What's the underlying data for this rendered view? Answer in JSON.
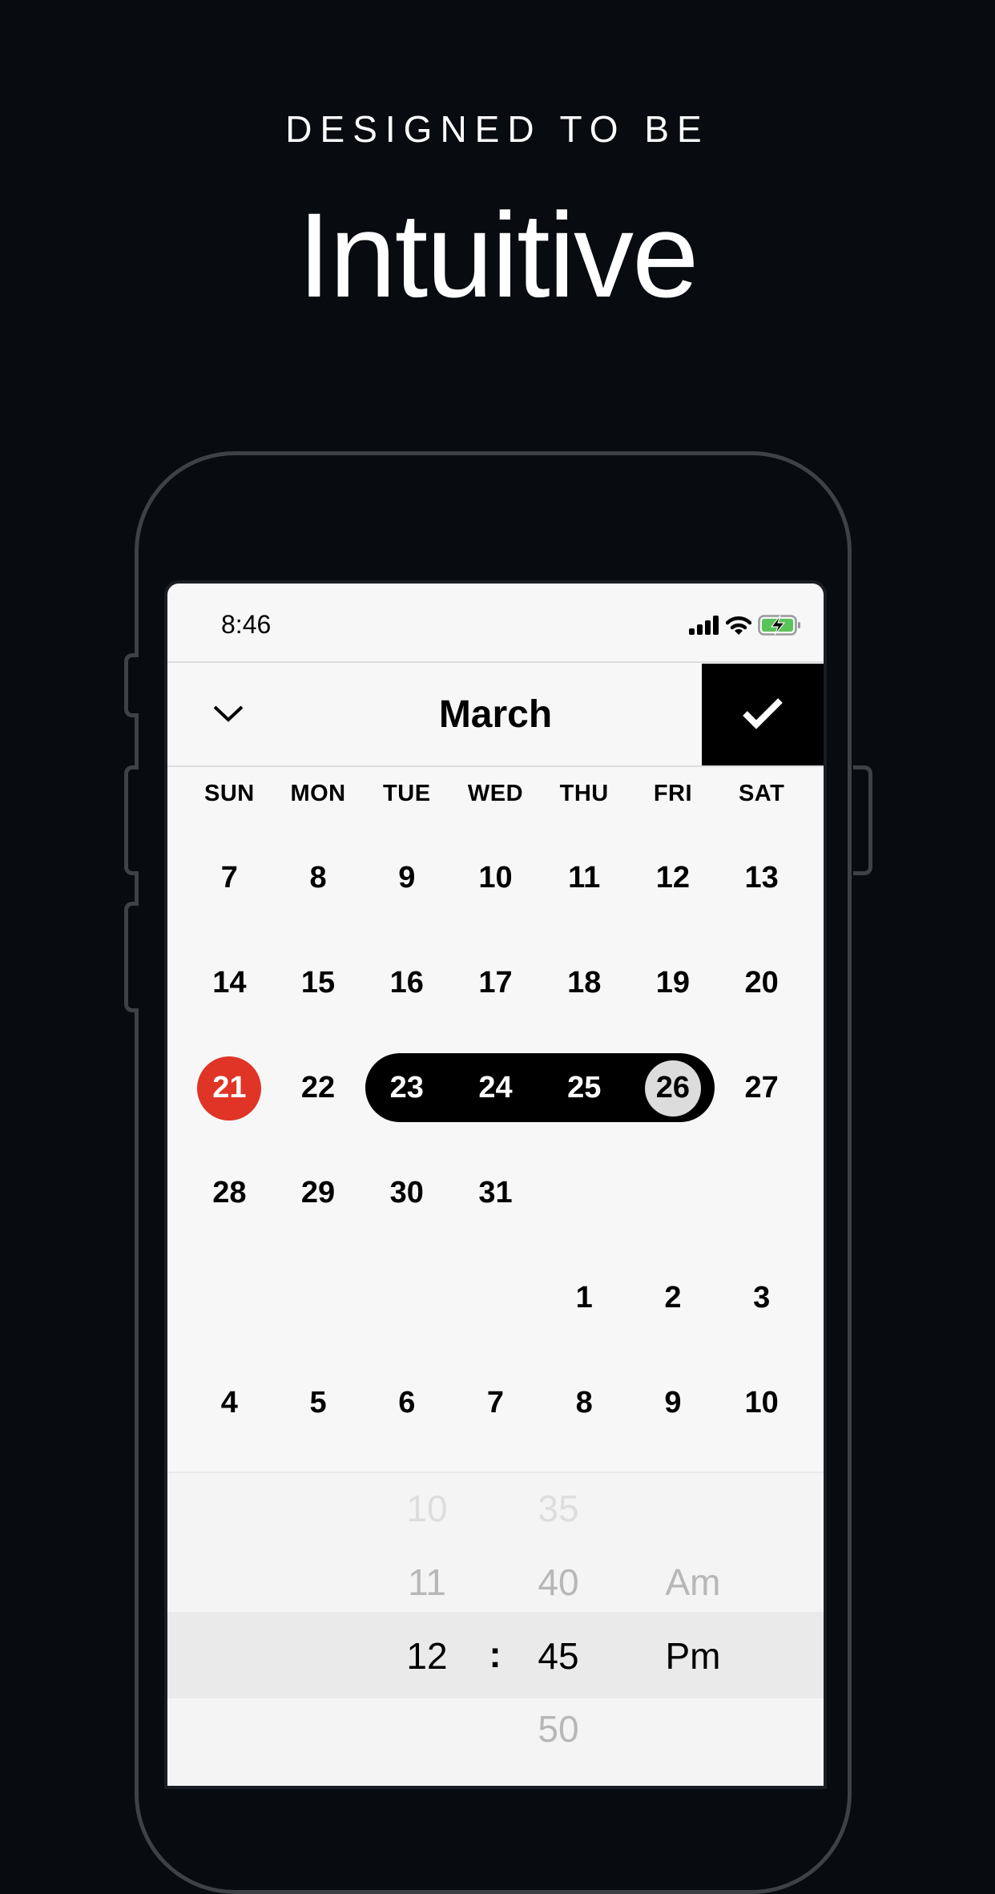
{
  "promo": {
    "eyebrow": "DESIGNED TO BE",
    "headline": "Intuitive"
  },
  "status_bar": {
    "time": "8:46",
    "icons": [
      "cellular-signal-icon",
      "wifi-icon",
      "battery-charging-icon"
    ],
    "battery_color": "#5ac35a"
  },
  "header": {
    "collapse_icon": "chevron-down-icon",
    "month": "March",
    "confirm_icon": "checkmark-icon"
  },
  "weekdays": [
    "SUN",
    "MON",
    "TUE",
    "WED",
    "THU",
    "FRI",
    "SAT"
  ],
  "calendar": {
    "weeks": [
      [
        "7",
        "8",
        "9",
        "10",
        "11",
        "12",
        "13"
      ],
      [
        "14",
        "15",
        "16",
        "17",
        "18",
        "19",
        "20"
      ],
      [
        "21",
        "22",
        "23",
        "24",
        "25",
        "26",
        "27"
      ],
      [
        "28",
        "29",
        "30",
        "31",
        "",
        "",
        ""
      ],
      [
        "",
        "",
        "",
        "",
        "1",
        "2",
        "3"
      ],
      [
        "4",
        "5",
        "6",
        "7",
        "8",
        "9",
        "10"
      ]
    ],
    "today": "21",
    "range_start": "23",
    "range_end": "26",
    "today_color": "#e03426",
    "range_color": "#000000",
    "range_end_color": "#dddcdd"
  },
  "time_picker": {
    "hours": [
      "10",
      "11",
      "12"
    ],
    "separator": ":",
    "minutes": [
      "35",
      "40",
      "45",
      "50"
    ],
    "periods": [
      "Am",
      "Pm"
    ],
    "selected": {
      "hour": "12",
      "minute": "45",
      "period": "Pm"
    }
  }
}
